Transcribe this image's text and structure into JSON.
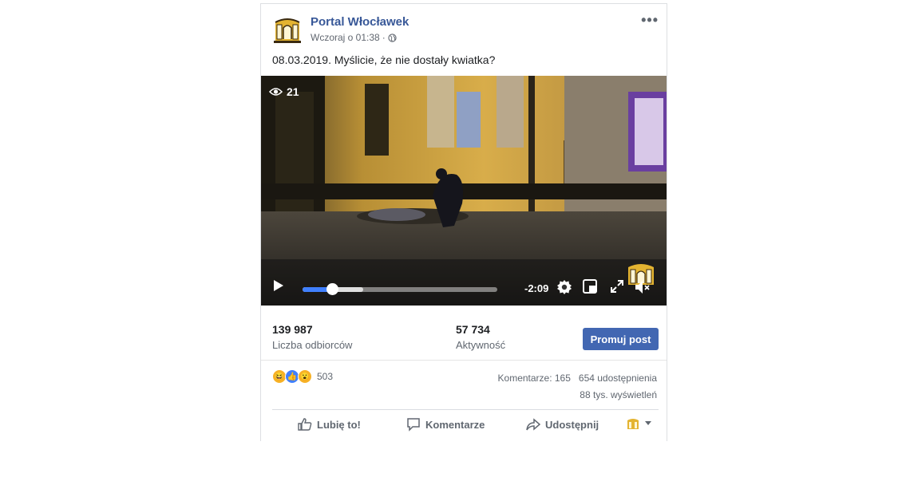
{
  "post": {
    "page_name": "Portal Włocławek",
    "timestamp": "Wczoraj o 01:38",
    "separator": "·",
    "caption": "08.03.2019. Myślicie, że nie dostały kwiatka?"
  },
  "video": {
    "views": "21",
    "time_remaining": "-2:09",
    "progress_fraction": 0.15,
    "buffered_fraction": 0.31
  },
  "stats": {
    "reach_value": "139 987",
    "reach_label": "Liczba odbiorców",
    "engagement_value": "57 734",
    "engagement_label": "Aktywność",
    "promote_label": "Promuj post"
  },
  "engagement": {
    "reaction_icons": [
      "haha-icon",
      "like-icon",
      "wow-icon"
    ],
    "reaction_count": "503",
    "comments_shares": "Komentarze: 165   654 udostępnienia",
    "views_text": "88 tys. wyświetleń"
  },
  "actions": {
    "like": "Lubię to!",
    "comment": "Komentarze",
    "share": "Udostępnij"
  },
  "colors": {
    "link_blue": "#385898",
    "button_blue": "#4267b2",
    "progress_blue": "#4080ff",
    "muted_text": "#606770"
  }
}
